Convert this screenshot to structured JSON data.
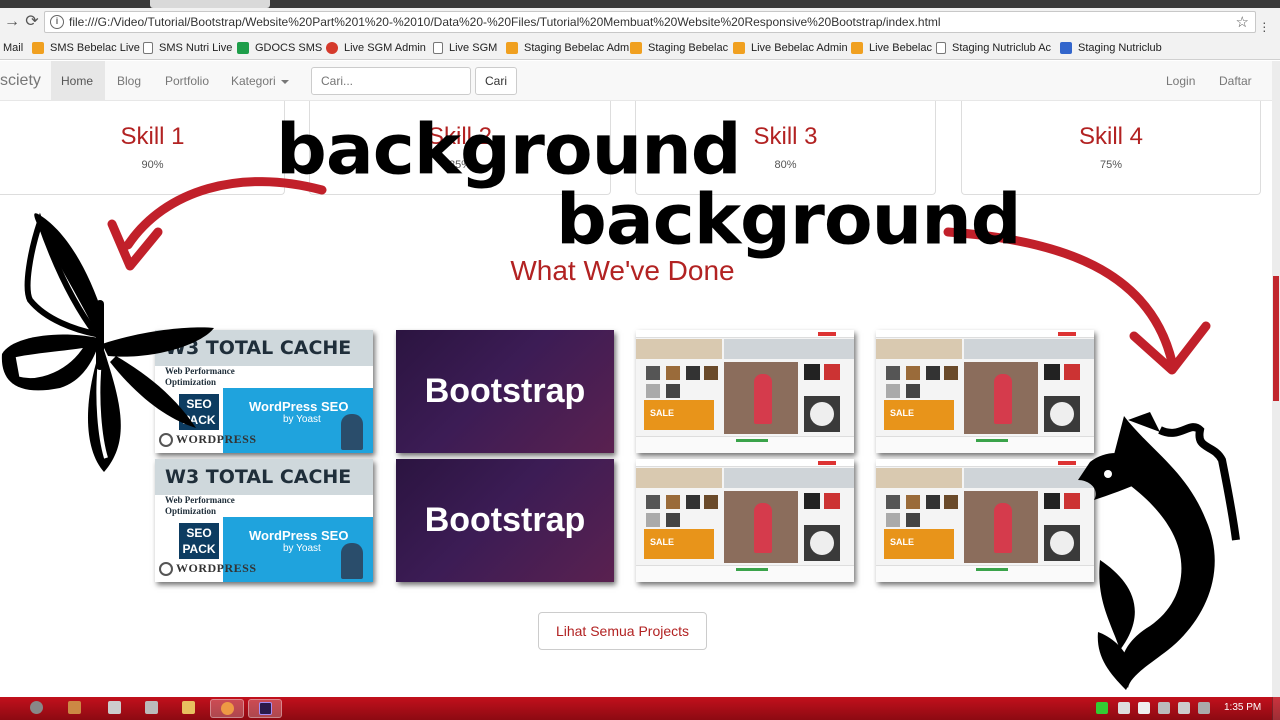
{
  "browser": {
    "url": "file:///G:/Video/Tutorial/Bootstrap/Website%20Part%201%20-%2010/Data%20-%20Files/Tutorial%20Membuat%20Website%20Responsive%20Bootstrap/index.html",
    "bookmarks": [
      {
        "label": "Mail",
        "icon": "mail-icon"
      },
      {
        "label": "SMS Bebelac Live",
        "icon": "bookmark-favicon-icon"
      },
      {
        "label": "SMS Nutri Live",
        "icon": "page-icon"
      },
      {
        "label": "GDOCS SMS",
        "icon": "sheets-icon"
      },
      {
        "label": "Live SGM Admin",
        "icon": "red-favicon-icon"
      },
      {
        "label": "Live SGM",
        "icon": "page-icon"
      },
      {
        "label": "Staging Bebelac Adm",
        "icon": "bookmark-favicon-icon"
      },
      {
        "label": "Staging Bebelac",
        "icon": "bookmark-favicon-icon"
      },
      {
        "label": "Live Bebelac Admin",
        "icon": "bookmark-favicon-icon"
      },
      {
        "label": "Live Bebelac",
        "icon": "bookmark-favicon-icon"
      },
      {
        "label": "Staging Nutriclub Ac",
        "icon": "page-icon"
      },
      {
        "label": "Staging Nutriclub",
        "icon": "blue-favicon-icon"
      }
    ]
  },
  "navbar": {
    "brand": "sciety",
    "items": [
      {
        "label": "Home",
        "active": true
      },
      {
        "label": "Blog"
      },
      {
        "label": "Portfolio"
      },
      {
        "label": "Kategori",
        "dropdown": true
      }
    ],
    "search_placeholder": "Cari...",
    "search_button": "Cari",
    "login": "Login",
    "register": "Daftar"
  },
  "skills": [
    {
      "title": "Skill 1",
      "percent": "90%"
    },
    {
      "title": "Skill 2",
      "percent": "85%"
    },
    {
      "title": "Skill 3",
      "percent": "80%"
    },
    {
      "title": "Skill 4",
      "percent": "75%"
    }
  ],
  "section_title": "What We've Done",
  "projects": {
    "w3": {
      "title": "W3 TOTAL CACHE",
      "subtitle_line1": "Web Performance",
      "subtitle_line2": "Optimization",
      "seo_pack": "SEO PACK",
      "yoast": "WordPress SEO",
      "by_yoast": "by Yoast",
      "wordpress": "WORDPRESS"
    },
    "bootstrap": "Bootstrap",
    "shop_sale": "SALE"
  },
  "cta_label": "Lihat Semua Projects",
  "overlay": {
    "text1": "background",
    "text2": "background",
    "arrow_color": "#c1202a"
  },
  "taskbar": {
    "time": "1:35 PM",
    "accent": "#b50d17"
  }
}
